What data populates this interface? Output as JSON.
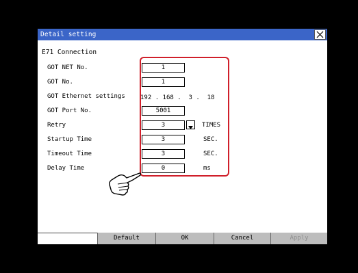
{
  "dialog": {
    "title": "Detail setting",
    "section": "E71 Connection"
  },
  "fields": {
    "got_net_no": {
      "label": "GOT NET No.",
      "value": "1"
    },
    "got_no": {
      "label": "GOT No.",
      "value": "1"
    },
    "ethernet": {
      "label": "GOT Ethernet settings",
      "octet1": "192",
      "octet2": "168",
      "octet3": "3",
      "octet4": "18",
      "sep": "."
    },
    "port": {
      "label": "GOT Port No.",
      "value": "5001"
    },
    "retry": {
      "label": "Retry",
      "value": "3",
      "unit": "TIMES"
    },
    "startup": {
      "label": "Startup Time",
      "value": "3",
      "unit": "SEC."
    },
    "timeout": {
      "label": "Timeout Time",
      "value": "3",
      "unit": "SEC."
    },
    "delay": {
      "label": "Delay Time",
      "value": "0",
      "unit": "ms"
    }
  },
  "buttons": {
    "default": "Default",
    "ok": "OK",
    "cancel": "Cancel",
    "apply": "Apply"
  },
  "colors": {
    "titlebar": "#3b65c8",
    "highlight": "#d01f2a",
    "button": "#bdbdbd"
  },
  "icons": {
    "close": "close-icon",
    "dropdown": "triangle-down-icon",
    "pointer": "pointing-hand-icon"
  }
}
